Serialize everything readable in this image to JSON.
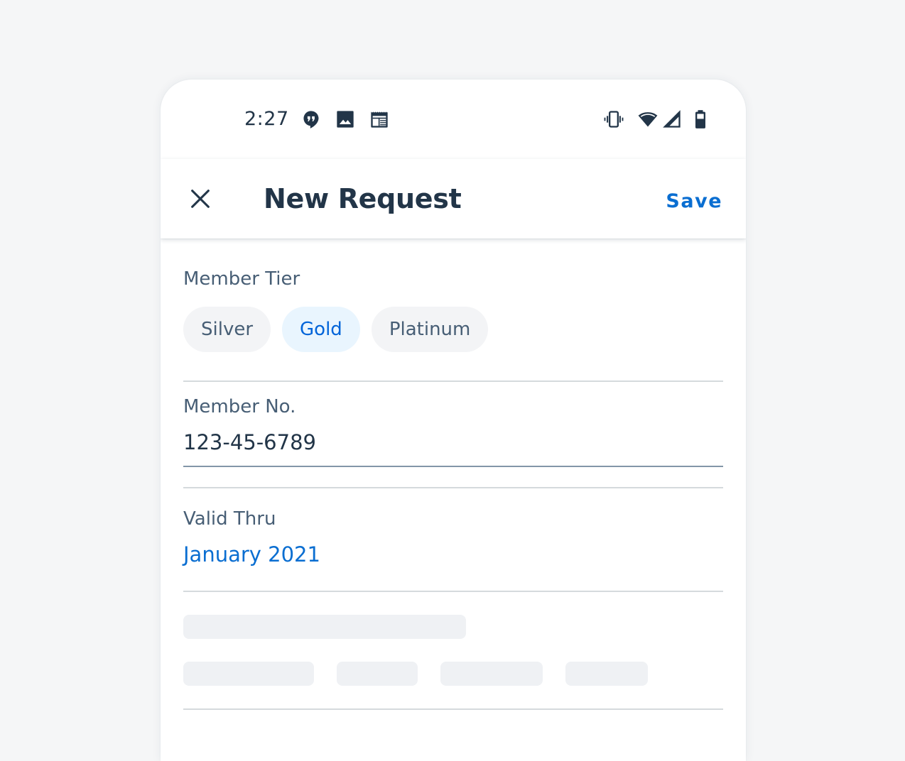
{
  "status_bar": {
    "time": "2:27",
    "left_icons": [
      "hangouts-icon",
      "image-icon",
      "calendar-icon"
    ],
    "right_icons": [
      "vibrate-icon",
      "wifi-icon",
      "signal-icon",
      "battery-icon"
    ]
  },
  "header": {
    "close_icon": "close-icon",
    "title": "New Request",
    "save_label": "Save"
  },
  "form": {
    "member_tier": {
      "label": "Member Tier",
      "options": [
        {
          "label": "Silver",
          "selected": false
        },
        {
          "label": "Gold",
          "selected": true
        },
        {
          "label": "Platinum",
          "selected": false
        }
      ]
    },
    "member_no": {
      "label": "Member No.",
      "value": "123-45-6789"
    },
    "valid_thru": {
      "label": "Valid Thru",
      "value": "January 2021"
    }
  },
  "colors": {
    "accent": "#0a6ed1",
    "text_primary": "#223548",
    "text_label": "#475e75",
    "chip_bg": "#f3f4f6",
    "chip_selected_bg": "#e9f5fe",
    "skeleton": "#eff1f4",
    "divider": "#d5dadd"
  }
}
